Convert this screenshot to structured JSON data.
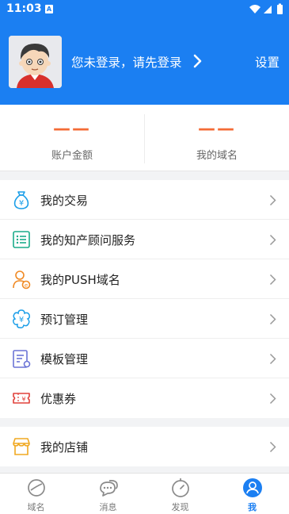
{
  "status_bar": {
    "time": "11:03",
    "notification_badge": "A"
  },
  "header": {
    "login_prompt": "您未登录，请先登录",
    "settings_label": "设置",
    "background_color": "#1b7ff2"
  },
  "stats": [
    {
      "value": "——",
      "label": "账户金额"
    },
    {
      "value": "——",
      "label": "我的域名"
    }
  ],
  "menu_group_1": [
    {
      "label": "我的交易",
      "icon": "money-bag-icon"
    },
    {
      "label": "我的知产顾问服务",
      "icon": "list-icon"
    },
    {
      "label": "我的PUSH域名",
      "icon": "user-push-icon"
    },
    {
      "label": "预订管理",
      "icon": "yen-flower-icon"
    },
    {
      "label": "模板管理",
      "icon": "template-icon"
    },
    {
      "label": "优惠券",
      "icon": "coupon-icon"
    }
  ],
  "menu_group_2": [
    {
      "label": "我的店铺",
      "icon": "store-icon"
    }
  ],
  "tabs": [
    {
      "label": "域名",
      "icon": "domain-planet-icon",
      "active": false
    },
    {
      "label": "消息",
      "icon": "message-icon",
      "active": false
    },
    {
      "label": "发现",
      "icon": "compass-icon",
      "active": false
    },
    {
      "label": "我",
      "icon": "profile-icon",
      "active": true
    }
  ],
  "colors": {
    "accent": "#1b7ff2",
    "stat_value": "#f46b36"
  }
}
